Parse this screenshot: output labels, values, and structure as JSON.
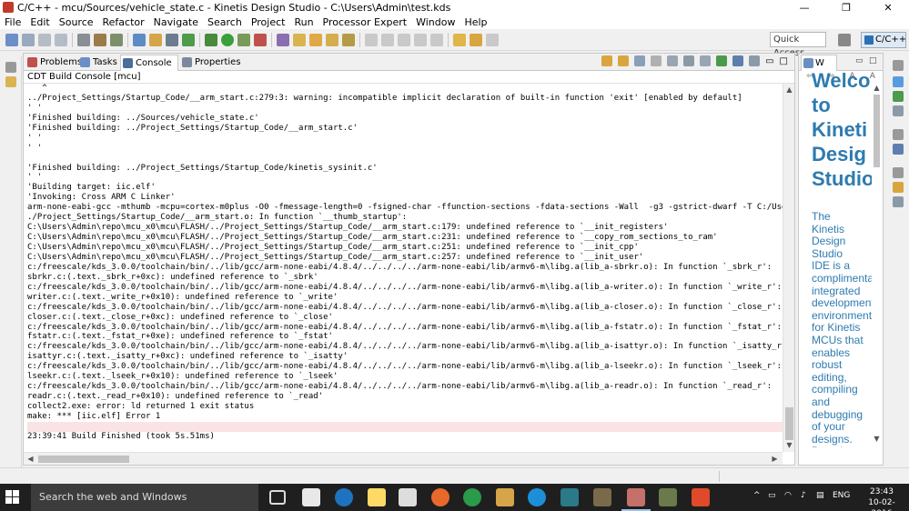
{
  "window": {
    "title": "C/C++ - mcu/Sources/vehicle_state.c - Kinetis Design Studio - C:\\Users\\Admin\\test.kds",
    "minimize": "—",
    "maximize": "❐",
    "close": "✕"
  },
  "menu": [
    "File",
    "Edit",
    "Source",
    "Refactor",
    "Navigate",
    "Search",
    "Project",
    "Run",
    "Processor Expert",
    "Window",
    "Help"
  ],
  "toolbar": {
    "quick_access": "Quick Access",
    "perspective": "C/C++"
  },
  "console_view": {
    "tabs": [
      {
        "label": "Problems",
        "icon": "problems-icon"
      },
      {
        "label": "Tasks",
        "icon": "tasks-icon"
      },
      {
        "label": "Console",
        "icon": "console-icon"
      },
      {
        "label": "Properties",
        "icon": "properties-icon"
      }
    ],
    "subtitle": "CDT Build Console [mcu]",
    "lines": [
      "   ^",
      "../Project_Settings/Startup_Code/__arm_start.c:279:3: warning: incompatible implicit declaration of built-in function 'exit' [enabled by default]",
      "' '",
      "'Finished building: ../Sources/vehicle_state.c'",
      "'Finished building: ../Project_Settings/Startup_Code/__arm_start.c'",
      "' '",
      "' '",
      "",
      "'Finished building: ../Project_Settings/Startup_Code/kinetis_sysinit.c'",
      "' '",
      "'Building target: iic.elf'",
      "'Invoking: Cross ARM C Linker'",
      "arm-none-eabi-gcc -mthumb -mcpu=cortex-m0plus -O0 -fmessage-length=0 -fsigned-char -ffunction-sections -fdata-sections -Wall  -g3 -gstrict-dwarf -T C:/Users/Admin,",
      "./Project_Settings/Startup_Code/__arm_start.o: In function `__thumb_startup':",
      "C:\\Users\\Admin\\repo\\mcu_x0\\mcu\\FLASH/../Project_Settings/Startup_Code/__arm_start.c:179: undefined reference to `__init_registers'",
      "C:\\Users\\Admin\\repo\\mcu_x0\\mcu\\FLASH/../Project_Settings/Startup_Code/__arm_start.c:231: undefined reference to `__copy_rom_sections_to_ram'",
      "C:\\Users\\Admin\\repo\\mcu_x0\\mcu\\FLASH/../Project_Settings/Startup_Code/__arm_start.c:251: undefined reference to `__init_cpp'",
      "C:\\Users\\Admin\\repo\\mcu_x0\\mcu\\FLASH/../Project_Settings/Startup_Code/__arm_start.c:257: undefined reference to `__init_user'",
      "c:/freescale/kds_3.0.0/toolchain/bin/../lib/gcc/arm-none-eabi/4.8.4/../../../../arm-none-eabi/lib/armv6-m\\libg.a(lib_a-sbrkr.o): In function `_sbrk_r':",
      "sbrkr.c:(.text._sbrk_r+0xc): undefined reference to `_sbrk'",
      "c:/freescale/kds_3.0.0/toolchain/bin/../lib/gcc/arm-none-eabi/4.8.4/../../../../arm-none-eabi/lib/armv6-m\\libg.a(lib_a-writer.o): In function `_write_r':",
      "writer.c:(.text._write_r+0x10): undefined reference to `_write'",
      "c:/freescale/kds_3.0.0/toolchain/bin/../lib/gcc/arm-none-eabi/4.8.4/../../../../arm-none-eabi/lib/armv6-m\\libg.a(lib_a-closer.o): In function `_close_r':",
      "closer.c:(.text._close_r+0xc): undefined reference to `_close'",
      "c:/freescale/kds_3.0.0/toolchain/bin/../lib/gcc/arm-none-eabi/4.8.4/../../../../arm-none-eabi/lib/armv6-m\\libg.a(lib_a-fstatr.o): In function `_fstat_r':",
      "fstatr.c:(.text._fstat_r+0xe): undefined reference to `_fstat'",
      "c:/freescale/kds_3.0.0/toolchain/bin/../lib/gcc/arm-none-eabi/4.8.4/../../../../arm-none-eabi/lib/armv6-m\\libg.a(lib_a-isattyr.o): In function `_isatty_r':",
      "isattyr.c:(.text._isatty_r+0xc): undefined reference to `_isatty'",
      "c:/freescale/kds_3.0.0/toolchain/bin/../lib/gcc/arm-none-eabi/4.8.4/../../../../arm-none-eabi/lib/armv6-m\\libg.a(lib_a-lseekr.o): In function `_lseek_r':",
      "lseekr.c:(.text._lseek_r+0x10): undefined reference to `_lseek'",
      "c:/freescale/kds_3.0.0/toolchain/bin/../lib/gcc/arm-none-eabi/4.8.4/../../../../arm-none-eabi/lib/armv6-m\\libg.a(lib_a-readr.o): In function `_read_r':",
      "readr.c:(.text._read_r+0x10): undefined reference to `_read'",
      "collect2.exe: error: ld returned 1 exit status",
      "make: *** [iic.elf] Error 1",
      "",
      "23:39:41 Build Finished (took 5s.51ms)",
      "",
      "|"
    ],
    "error_line_index": 34,
    "finished_line_index": 36
  },
  "welcome_view": {
    "tab_label": "W",
    "heading": [
      "Welco",
      "to",
      "Kineti",
      "Desig",
      "Studio"
    ],
    "body": [
      "The",
      "Kinetis",
      "Design",
      "Studio",
      "IDE is a",
      "complimenta",
      "integrated",
      "development",
      "environment",
      "for Kinetis",
      "MCUs that",
      "enables",
      "robust",
      "editing,",
      "compiling",
      "and",
      "debugging",
      "of your",
      "designs.",
      "Based on"
    ]
  },
  "taskbar": {
    "search_placeholder": "Search the web and Windows",
    "language": "ENG",
    "time": "23:43",
    "date": "10-02-2016"
  },
  "colors": {
    "accent": "#2e7bb0",
    "error_bg": "#fbe3e4",
    "finished_text": "#1b54b5",
    "taskbar": "#1f1f1f"
  }
}
